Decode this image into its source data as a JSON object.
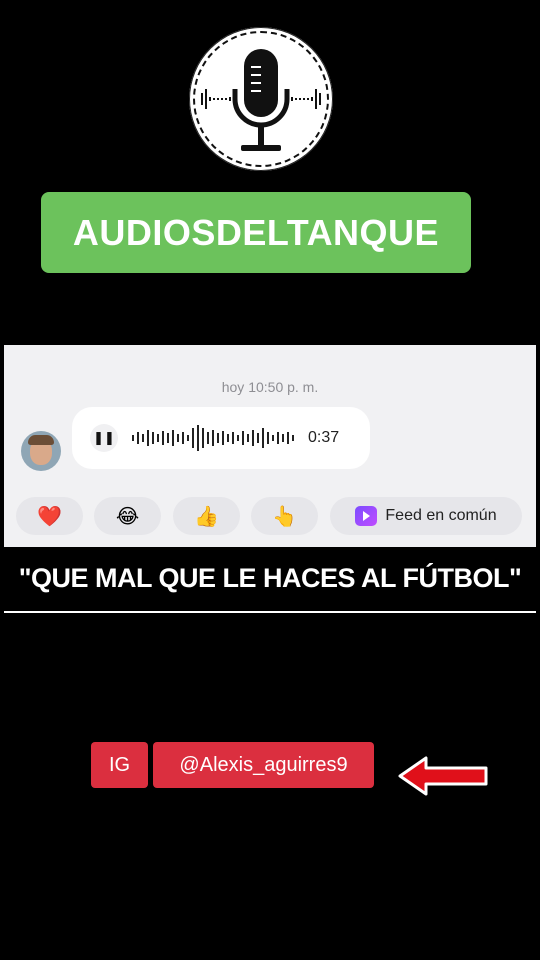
{
  "logo": {
    "icon": "microphone-icon"
  },
  "brand": {
    "title": "AUDIOSDELTANQUE",
    "color": "#6cc25c"
  },
  "chat": {
    "timestamp": "hoy 10:50 p. m.",
    "voice_message": {
      "duration": "0:37",
      "play_icon": "pause-icon"
    },
    "reactions": [
      {
        "emoji": "❤️",
        "icon": "heart-icon"
      },
      {
        "emoji": "😂",
        "icon": "laughing-icon"
      },
      {
        "emoji": "👍",
        "icon": "thumbs-up-icon"
      },
      {
        "emoji": "👆",
        "icon": "pointing-icon"
      }
    ],
    "feed_button": {
      "label": "Feed en común",
      "icon": "feed-icon"
    }
  },
  "quote": "\"QUE MAL QUE LE HACES AL FÚTBOL\"",
  "social": {
    "platform": "IG",
    "handle": "@Alexis_aguirres9",
    "color": "#db2f3f",
    "arrow_icon": "arrow-left-icon"
  }
}
